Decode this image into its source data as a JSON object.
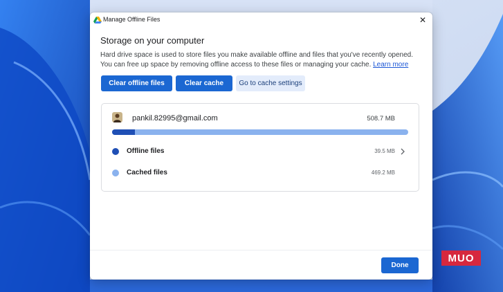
{
  "dialog": {
    "title": "Manage Offline Files",
    "close_label": "✕",
    "heading": "Storage on your computer",
    "description": "Hard drive space is used to store files you make available offline and files that you've recently opened. You can free up space by removing offline access to these files or managing your cache.",
    "learn_more": "Learn more",
    "buttons": {
      "clear_offline": "Clear offline files",
      "clear_cache": "Clear cache",
      "cache_settings": "Go to cache settings"
    },
    "account": {
      "email": "pankil.82995@gmail.com",
      "total_size": "508.7 MB",
      "offline_fraction": 0.078
    },
    "rows": [
      {
        "label": "Offline files",
        "size": "39.5 MB"
      },
      {
        "label": "Cached files",
        "size": "469.2 MB"
      }
    ],
    "done_label": "Done"
  },
  "watermark": "MUO",
  "colors": {
    "primary": "#1b67d2",
    "offline_dot": "#1f4fb5",
    "cached_dot": "#8ab2ee",
    "wallpaper_blue": "#1766e0"
  },
  "icons": {
    "title": "google-drive-icon",
    "close": "close-icon",
    "row_chevron": "chevron-right-icon"
  }
}
